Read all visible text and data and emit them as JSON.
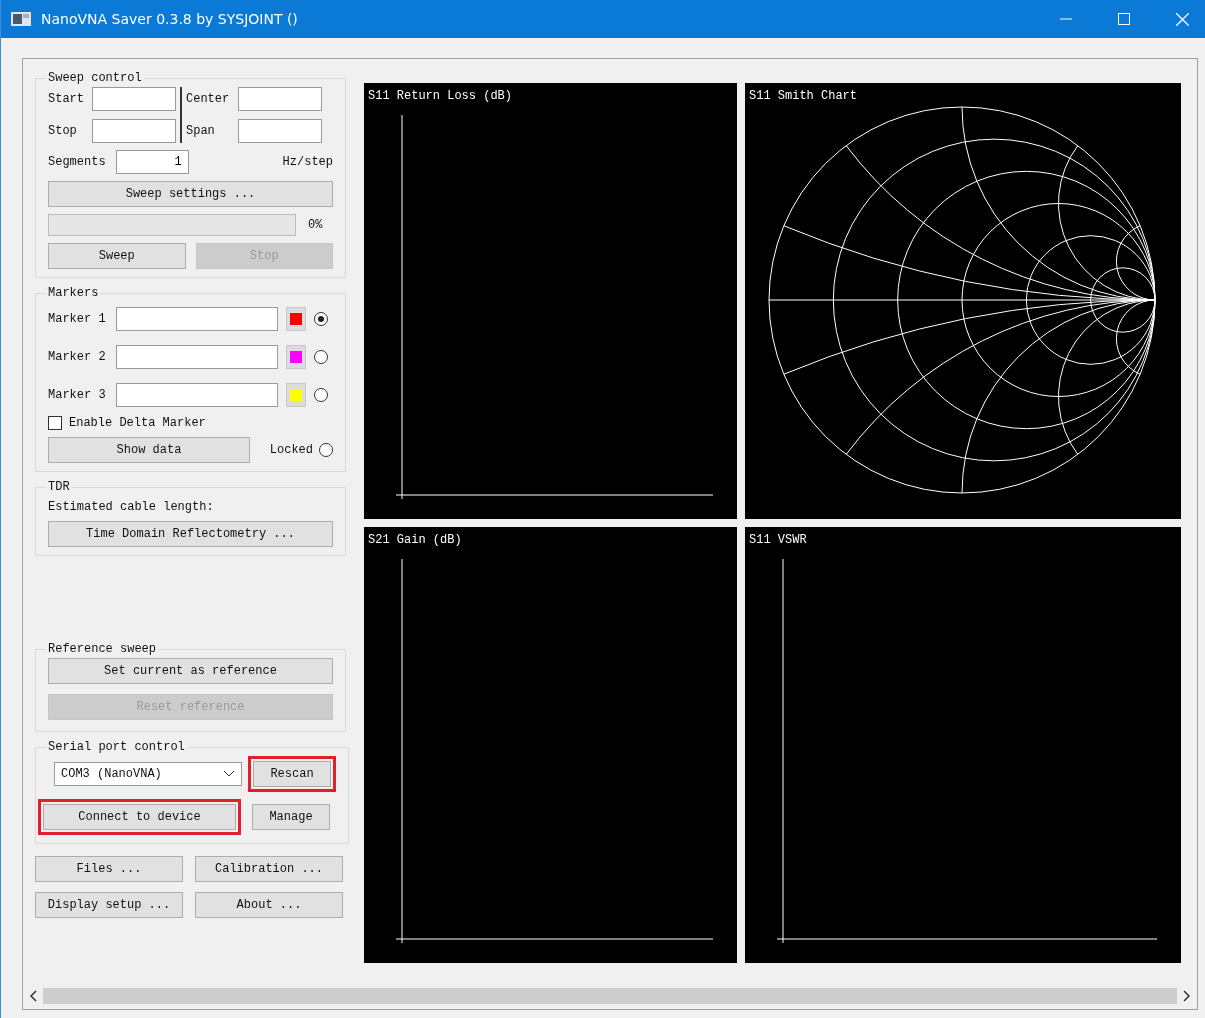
{
  "window": {
    "title": "NanoVNA Saver 0.3.8 by SYSJOINT ()"
  },
  "sweep_control": {
    "title": "Sweep control",
    "start": {
      "label": "Start"
    },
    "stop": {
      "label": "Stop"
    },
    "center": {
      "label": "Center"
    },
    "span": {
      "label": "Span"
    },
    "segments": {
      "label": "Segments",
      "value": "1"
    },
    "step_unit": "Hz/step",
    "settings_button": "Sweep settings ...",
    "progress": {
      "level": 0,
      "reading": "0%"
    },
    "buttons": [
      {
        "label": "Sweep",
        "disabled": false
      },
      {
        "label": "Stop",
        "disabled": true
      }
    ]
  },
  "markers": {
    "title": "Markers",
    "items": [
      {
        "label": "Marker 1",
        "color": "#ff0000",
        "selected": true
      },
      {
        "label": "Marker 2",
        "color": "#ff00ff",
        "selected": false
      },
      {
        "label": "Marker 3",
        "color": "#ffff00",
        "selected": false
      }
    ],
    "delta": {
      "label": "Enable Delta Marker",
      "checked": false
    },
    "show_data": "Show data",
    "locked": {
      "label": "Locked",
      "selected": false
    }
  },
  "tdr": {
    "title": "TDR",
    "cable_length_label": "Estimated cable length:",
    "button": "Time Domain Reflectometry ..."
  },
  "reference_sweep": {
    "title": "Reference sweep",
    "buttons": [
      {
        "label": "Set current as reference",
        "disabled": false
      },
      {
        "label": "Reset reference",
        "disabled": true
      }
    ]
  },
  "serial_port": {
    "title": "Serial port control",
    "port": {
      "value": "COM3 (NanoVNA)"
    },
    "rescan": {
      "label": "Rescan",
      "highlighted": true
    },
    "connect": {
      "label": "Connect to device",
      "highlighted": true
    },
    "manage": {
      "label": "Manage",
      "highlighted": false
    }
  },
  "bottom_buttons": [
    "Files ...",
    "Calibration ...",
    "Display setup ...",
    "About ..."
  ],
  "charts": [
    {
      "title": "S11 Return Loss (dB)",
      "kind": "axes"
    },
    {
      "title": "S11 Smith Chart",
      "kind": "smith"
    },
    {
      "title": "S21 Gain (dB)",
      "kind": "axes"
    },
    {
      "title": "S11 VSWR",
      "kind": "axes"
    }
  ]
}
